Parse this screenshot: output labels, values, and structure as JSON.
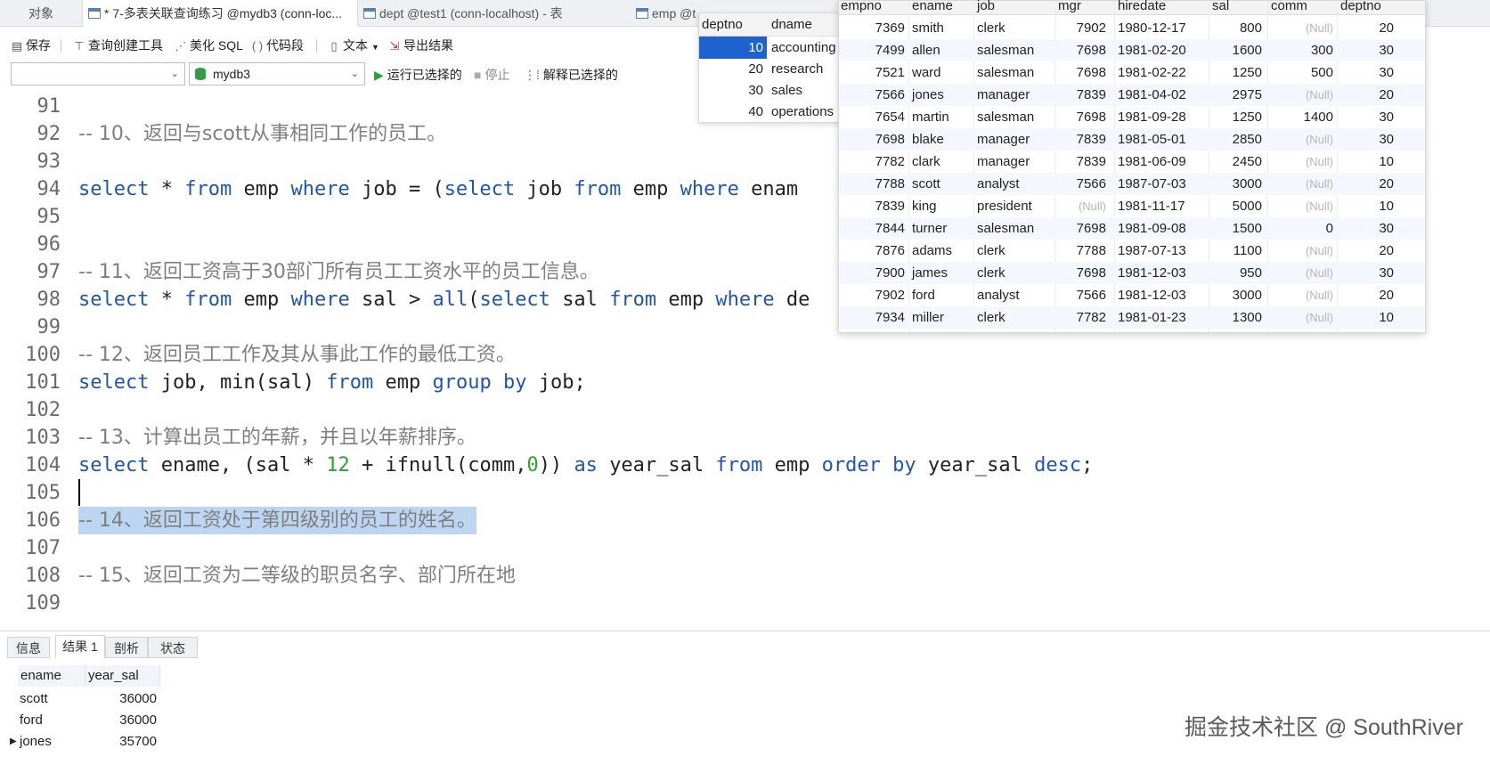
{
  "tabs": [
    {
      "label": "对象"
    },
    {
      "label": "* 7-多表关联查询练习 @mydb3 (conn-loc..."
    },
    {
      "label": "dept @test1 (conn-localhost) - 表"
    },
    {
      "label": "emp @t"
    }
  ],
  "toolbar": {
    "save": "保存",
    "query_builder": "查询创建工具",
    "beautify_sql": "美化 SQL",
    "code_snippet": "代码段",
    "text": "文本",
    "export": "导出结果"
  },
  "selectors": {
    "connection": "",
    "database": "mydb3",
    "run_selected": "运行已选择的",
    "stop": "停止",
    "explain_selected": "解释已选择的"
  },
  "editor": {
    "lines": [
      {
        "n": "91",
        "text": ""
      },
      {
        "n": "92",
        "text": "-- 10、返回与scott从事相同工作的员工。"
      },
      {
        "n": "93",
        "text": ""
      },
      {
        "n": "94",
        "text": "select * from emp where job = (select job from emp where enam"
      },
      {
        "n": "95",
        "text": ""
      },
      {
        "n": "96",
        "text": ""
      },
      {
        "n": "97",
        "text": "-- 11、返回工资高于30部门所有员工工资水平的员工信息。"
      },
      {
        "n": "98",
        "text": "select * from emp where sal > all(select sal from emp where de"
      },
      {
        "n": "99",
        "text": ""
      },
      {
        "n": "100",
        "text": "-- 12、返回员工工作及其从事此工作的最低工资。"
      },
      {
        "n": "101",
        "text": "select job, min(sal) from emp group by job;"
      },
      {
        "n": "102",
        "text": ""
      },
      {
        "n": "103",
        "text": "-- 13、计算出员工的年薪，并且以年薪排序。"
      },
      {
        "n": "104",
        "text": "select ename, (sal * 12 + ifnull(comm,0)) as year_sal from emp order by year_sal desc;"
      },
      {
        "n": "105",
        "text": ""
      },
      {
        "n": "106",
        "text": "-- 14、返回工资处于第四级别的员工的姓名。"
      },
      {
        "n": "107",
        "text": ""
      },
      {
        "n": "108",
        "text": "-- 15、返回工资为二等级的职员名字、部门所在地"
      },
      {
        "n": "109",
        "text": ""
      }
    ]
  },
  "dept_grid": {
    "columns": [
      "deptno",
      "dname"
    ],
    "rows": [
      {
        "deptno": "10",
        "dname": "accounting",
        "selected": true
      },
      {
        "deptno": "20",
        "dname": "research"
      },
      {
        "deptno": "30",
        "dname": "sales"
      },
      {
        "deptno": "40",
        "dname": "operations"
      }
    ]
  },
  "emp_grid": {
    "columns": [
      "empno",
      "ename",
      "job",
      "mgr",
      "hiredate",
      "sal",
      "comm",
      "deptno"
    ],
    "rows": [
      {
        "empno": "7369",
        "ename": "smith",
        "job": "clerk",
        "mgr": "7902",
        "hiredate": "1980-12-17",
        "sal": "800",
        "comm": "(Null)",
        "deptno": "20"
      },
      {
        "empno": "7499",
        "ename": "allen",
        "job": "salesman",
        "mgr": "7698",
        "hiredate": "1981-02-20",
        "sal": "1600",
        "comm": "300",
        "deptno": "30"
      },
      {
        "empno": "7521",
        "ename": "ward",
        "job": "salesman",
        "mgr": "7698",
        "hiredate": "1981-02-22",
        "sal": "1250",
        "comm": "500",
        "deptno": "30"
      },
      {
        "empno": "7566",
        "ename": "jones",
        "job": "manager",
        "mgr": "7839",
        "hiredate": "1981-04-02",
        "sal": "2975",
        "comm": "(Null)",
        "deptno": "20"
      },
      {
        "empno": "7654",
        "ename": "martin",
        "job": "salesman",
        "mgr": "7698",
        "hiredate": "1981-09-28",
        "sal": "1250",
        "comm": "1400",
        "deptno": "30"
      },
      {
        "empno": "7698",
        "ename": "blake",
        "job": "manager",
        "mgr": "7839",
        "hiredate": "1981-05-01",
        "sal": "2850",
        "comm": "(Null)",
        "deptno": "30"
      },
      {
        "empno": "7782",
        "ename": "clark",
        "job": "manager",
        "mgr": "7839",
        "hiredate": "1981-06-09",
        "sal": "2450",
        "comm": "(Null)",
        "deptno": "10"
      },
      {
        "empno": "7788",
        "ename": "scott",
        "job": "analyst",
        "mgr": "7566",
        "hiredate": "1987-07-03",
        "sal": "3000",
        "comm": "(Null)",
        "deptno": "20"
      },
      {
        "empno": "7839",
        "ename": "king",
        "job": "president",
        "mgr": "(Null)",
        "hiredate": "1981-11-17",
        "sal": "5000",
        "comm": "(Null)",
        "deptno": "10"
      },
      {
        "empno": "7844",
        "ename": "turner",
        "job": "salesman",
        "mgr": "7698",
        "hiredate": "1981-09-08",
        "sal": "1500",
        "comm": "0",
        "deptno": "30"
      },
      {
        "empno": "7876",
        "ename": "adams",
        "job": "clerk",
        "mgr": "7788",
        "hiredate": "1987-07-13",
        "sal": "1100",
        "comm": "(Null)",
        "deptno": "20"
      },
      {
        "empno": "7900",
        "ename": "james",
        "job": "clerk",
        "mgr": "7698",
        "hiredate": "1981-12-03",
        "sal": "950",
        "comm": "(Null)",
        "deptno": "30"
      },
      {
        "empno": "7902",
        "ename": "ford",
        "job": "analyst",
        "mgr": "7566",
        "hiredate": "1981-12-03",
        "sal": "3000",
        "comm": "(Null)",
        "deptno": "20"
      },
      {
        "empno": "7934",
        "ename": "miller",
        "job": "clerk",
        "mgr": "7782",
        "hiredate": "1981-01-23",
        "sal": "1300",
        "comm": "(Null)",
        "deptno": "10"
      }
    ]
  },
  "bottom_panel": {
    "tabs": [
      "信息",
      "结果 1",
      "剖析",
      "状态"
    ],
    "active_tab": "结果 1",
    "result": {
      "columns": [
        "ename",
        "year_sal"
      ],
      "rows": [
        {
          "ename": "scott",
          "year_sal": "36000"
        },
        {
          "ename": "ford",
          "year_sal": "36000"
        },
        {
          "ename": "jones",
          "year_sal": "35700"
        }
      ]
    }
  },
  "watermark": "掘金技术社区 @ SouthRiver",
  "colors": {
    "keyword": "#1f55b5",
    "comment": "#7f7f7f",
    "number": "#2aa530",
    "selection": "#bcd5f0",
    "grid_selected": "#1e62d0"
  }
}
